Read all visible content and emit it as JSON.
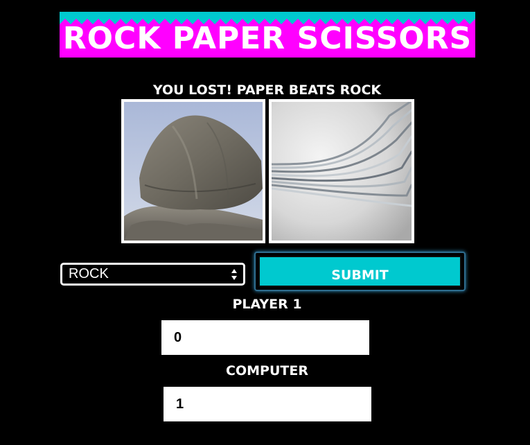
{
  "header": {
    "title": "ROCK PAPER SCISSORS",
    "banner_color": "#ff00ff",
    "zigzag_color": "#00c9cf"
  },
  "result": {
    "message": "YOU LOST! PAPER BEATS ROCK"
  },
  "images": {
    "player_choice_icon": "rock-image",
    "computer_choice_icon": "paper-image"
  },
  "controls": {
    "select_value": "ROCK",
    "submit_label": "SUBMIT",
    "accent_color": "#00c9cf"
  },
  "scores": {
    "player_label": "PLAYER 1",
    "player_value": "0",
    "computer_label": "COMPUTER",
    "computer_value": "1"
  }
}
